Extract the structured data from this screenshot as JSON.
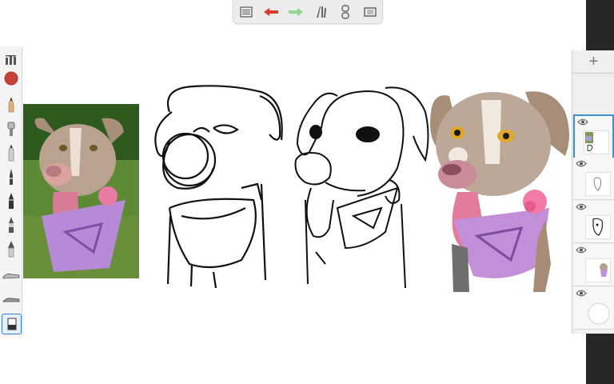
{
  "app": {
    "accent_color": "#2f7fd6",
    "undo_color": "#d93a2a",
    "redo_color": "#8fd48f",
    "brush_color": "#c9423a"
  },
  "toolbar": {
    "items": [
      "list-icon",
      "undo-arrow-icon",
      "redo-arrow-icon",
      "ruler-tools-icon",
      "symmetry-icon",
      "fullscreen-icon"
    ]
  },
  "palette": {
    "items": [
      "brush-library-icon",
      "color-puck",
      "pencil-icon",
      "airbrush-icon",
      "marker-icon",
      "ballpoint-pen-icon",
      "brush-pen-icon",
      "felt-tip-icon",
      "paint-brush-icon",
      "smudge-icon",
      "blender-icon",
      "eraser-icon"
    ],
    "active": "eraser-icon"
  },
  "layers": {
    "add_label": "+",
    "items": [
      "layer-5",
      "layer-4",
      "layer-3",
      "layer-2",
      "background-layer"
    ],
    "active": "layer-5"
  }
}
